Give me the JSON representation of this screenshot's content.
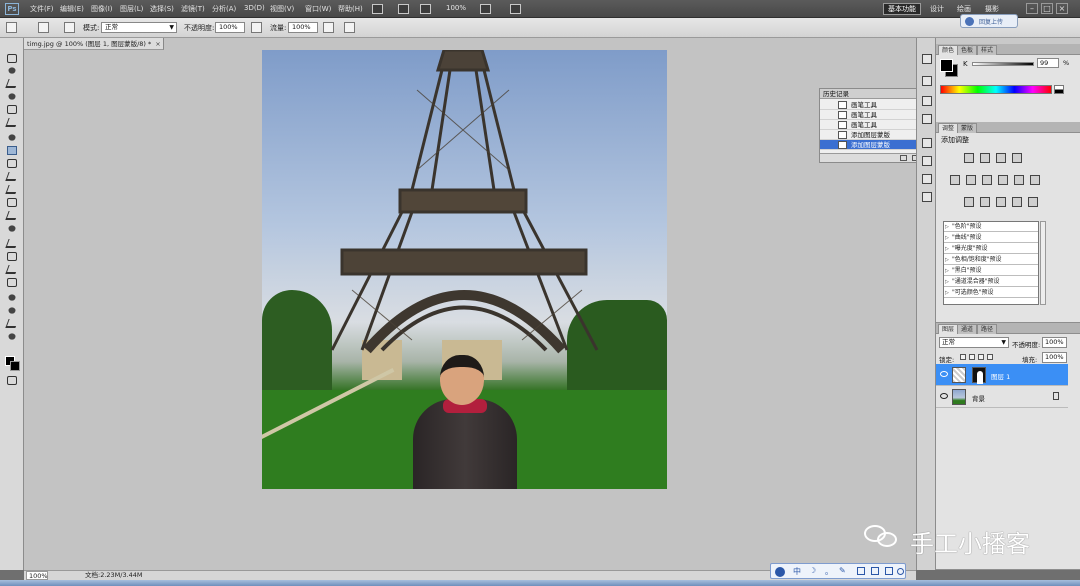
{
  "app": {
    "logo": "Ps",
    "menu": [
      "文件(F)",
      "编辑(E)",
      "图像(I)",
      "图层(L)",
      "选择(S)",
      "滤镜(T)",
      "分析(A)",
      "3D(D)",
      "视图(V)",
      "窗口(W)",
      "帮助(H)"
    ],
    "zoom": "100%",
    "workspace_active": "基本功能",
    "workspace_links": [
      "设计",
      "绘画",
      "摄影"
    ],
    "cs_live": "回复上传"
  },
  "options": {
    "mode_label": "模式:",
    "mode_value": "正常",
    "opacity_label": "不透明度:",
    "opacity_value": "100%",
    "flow_label": "流量:",
    "flow_value": "100%"
  },
  "document": {
    "tab": "timg.jpg @ 100% (图层 1, 图层蒙版/8) *",
    "tab_close": "×"
  },
  "history": {
    "title": "历史记录",
    "items": [
      "画笔工具",
      "画笔工具",
      "画笔工具",
      "添加图层蒙版",
      "添加图层蒙版"
    ],
    "selected_index": 4
  },
  "color_panel": {
    "tabs": [
      "颜色",
      "色板",
      "样式"
    ],
    "k_label": "K",
    "k_value": "99",
    "k_unit": "%"
  },
  "adjust_panel": {
    "tabs": [
      "调整",
      "蒙版"
    ],
    "title": "添加调整",
    "presets": [
      "\"色阶\"预设",
      "\"曲线\"预设",
      "\"曝光度\"预设",
      "\"色相/饱和度\"预设",
      "\"黑白\"预设",
      "\"通道混合器\"预设",
      "\"可选颜色\"预设"
    ]
  },
  "layers_panel": {
    "tabs": [
      "图层",
      "通道",
      "路径"
    ],
    "blend_mode": "正常",
    "opacity_label": "不透明度:",
    "opacity_value": "100%",
    "lock_label": "锁定:",
    "fill_label": "填充:",
    "fill_value": "100%",
    "layers": [
      {
        "name": "图层 1",
        "selected": true
      },
      {
        "name": "背景",
        "selected": false
      }
    ]
  },
  "status": {
    "zoom": "100%",
    "doc_info": "文档:2.23M/3.44M"
  },
  "watermark": "手工小播客",
  "ime": [
    "中",
    "☽",
    "。",
    "✎"
  ]
}
